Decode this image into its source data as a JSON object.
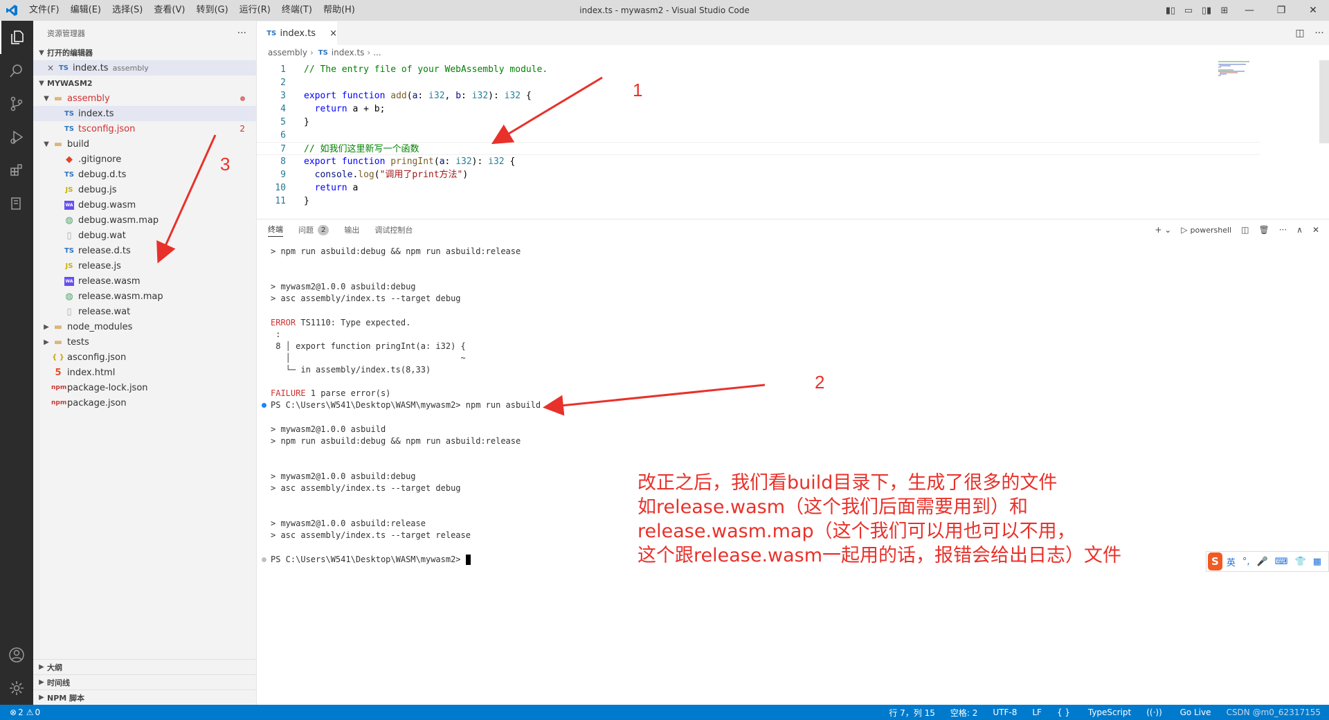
{
  "window": {
    "title": "index.ts - mywasm2 - Visual Studio Code",
    "menu": [
      "文件(F)",
      "编辑(E)",
      "选择(S)",
      "查看(V)",
      "转到(G)",
      "运行(R)",
      "终端(T)",
      "帮助(H)"
    ]
  },
  "sidebar": {
    "title": "资源管理器",
    "more": "···",
    "open_editors": {
      "label": "打开的编辑器",
      "items": [
        {
          "icon": "TS",
          "name": "index.ts",
          "desc": "assembly"
        }
      ]
    },
    "project": {
      "label": "MYWASM2",
      "tree": [
        {
          "icon": "folder",
          "name": "assembly",
          "level": 1,
          "open": true,
          "status": "red"
        },
        {
          "icon": "TS",
          "name": "index.ts",
          "level": 2,
          "selected": true
        },
        {
          "icon": "TS",
          "name": "tsconfig.json",
          "level": 2,
          "badge": "2",
          "status": "red"
        },
        {
          "icon": "folder",
          "name": "build",
          "level": 1,
          "open": true
        },
        {
          "icon": "git",
          "name": ".gitignore",
          "level": 2
        },
        {
          "icon": "TS",
          "name": "debug.d.ts",
          "level": 2
        },
        {
          "icon": "JS",
          "name": "debug.js",
          "level": 2
        },
        {
          "icon": "wasm",
          "name": "debug.wasm",
          "level": 2
        },
        {
          "icon": "globe",
          "name": "debug.wasm.map",
          "level": 2
        },
        {
          "icon": "file",
          "name": "debug.wat",
          "level": 2
        },
        {
          "icon": "TS",
          "name": "release.d.ts",
          "level": 2
        },
        {
          "icon": "JS",
          "name": "release.js",
          "level": 2
        },
        {
          "icon": "wasm",
          "name": "release.wasm",
          "level": 2
        },
        {
          "icon": "globe",
          "name": "release.wasm.map",
          "level": 2
        },
        {
          "icon": "file",
          "name": "release.wat",
          "level": 2
        },
        {
          "icon": "folder",
          "name": "node_modules",
          "level": 1,
          "open": false
        },
        {
          "icon": "folder",
          "name": "tests",
          "level": 1,
          "open": false
        },
        {
          "icon": "json",
          "name": "asconfig.json",
          "level": 1
        },
        {
          "icon": "html",
          "name": "index.html",
          "level": 1
        },
        {
          "icon": "npm",
          "name": "package-lock.json",
          "level": 1
        },
        {
          "icon": "npm",
          "name": "package.json",
          "level": 1
        }
      ]
    },
    "bottom_sections": [
      "大纲",
      "时间线",
      "NPM 脚本"
    ]
  },
  "editor": {
    "tab": {
      "icon": "TS",
      "label": "index.ts",
      "close": "×"
    },
    "breadcrumb": [
      "assembly",
      "index.ts",
      "..."
    ],
    "lines": [
      {
        "n": "1",
        "tokens": [
          {
            "t": "// The entry file of your WebAssembly module.",
            "c": "cm"
          }
        ]
      },
      {
        "n": "2",
        "tokens": []
      },
      {
        "n": "3",
        "tokens": [
          {
            "t": "export",
            "c": "kw"
          },
          {
            "t": " ",
            "c": "op"
          },
          {
            "t": "function",
            "c": "kw"
          },
          {
            "t": " ",
            "c": "op"
          },
          {
            "t": "add",
            "c": "fn"
          },
          {
            "t": "(",
            "c": "op"
          },
          {
            "t": "a",
            "c": "pr"
          },
          {
            "t": ": ",
            "c": "op"
          },
          {
            "t": "i32",
            "c": "ty"
          },
          {
            "t": ", ",
            "c": "op"
          },
          {
            "t": "b",
            "c": "pr"
          },
          {
            "t": ": ",
            "c": "op"
          },
          {
            "t": "i32",
            "c": "ty"
          },
          {
            "t": "): ",
            "c": "op"
          },
          {
            "t": "i32",
            "c": "ty"
          },
          {
            "t": " {",
            "c": "op"
          }
        ]
      },
      {
        "n": "4",
        "tokens": [
          {
            "t": "  ",
            "c": "op"
          },
          {
            "t": "return",
            "c": "kw"
          },
          {
            "t": " a + b;",
            "c": "op"
          }
        ]
      },
      {
        "n": "5",
        "tokens": [
          {
            "t": "}",
            "c": "op"
          }
        ]
      },
      {
        "n": "6",
        "tokens": []
      },
      {
        "n": "7",
        "tokens": [
          {
            "t": "// 如我们这里新写一个函数",
            "c": "cm"
          }
        ],
        "current": true
      },
      {
        "n": "8",
        "tokens": [
          {
            "t": "export",
            "c": "kw"
          },
          {
            "t": " ",
            "c": "op"
          },
          {
            "t": "function",
            "c": "kw"
          },
          {
            "t": " ",
            "c": "op"
          },
          {
            "t": "pringInt",
            "c": "fn"
          },
          {
            "t": "(",
            "c": "op"
          },
          {
            "t": "a",
            "c": "pr"
          },
          {
            "t": ": ",
            "c": "op"
          },
          {
            "t": "i32",
            "c": "ty"
          },
          {
            "t": "): ",
            "c": "op"
          },
          {
            "t": "i32",
            "c": "ty"
          },
          {
            "t": " {",
            "c": "op"
          }
        ]
      },
      {
        "n": "9",
        "tokens": [
          {
            "t": "  ",
            "c": "op"
          },
          {
            "t": "console",
            "c": "pr"
          },
          {
            "t": ".",
            "c": "op"
          },
          {
            "t": "log",
            "c": "fn"
          },
          {
            "t": "(",
            "c": "op"
          },
          {
            "t": "\"调用了print方法\"",
            "c": "str"
          },
          {
            "t": ")",
            "c": "op"
          }
        ]
      },
      {
        "n": "10",
        "tokens": [
          {
            "t": "  ",
            "c": "op"
          },
          {
            "t": "return",
            "c": "kw"
          },
          {
            "t": " a",
            "c": "op"
          }
        ]
      },
      {
        "n": "11",
        "tokens": [
          {
            "t": "}",
            "c": "op"
          }
        ]
      }
    ]
  },
  "panel": {
    "tabs": [
      {
        "label": "终端",
        "active": true
      },
      {
        "label": "问题",
        "badge": "2"
      },
      {
        "label": "输出"
      },
      {
        "label": "调试控制台"
      }
    ],
    "shell": "powershell",
    "terminal": [
      {
        "text": "> npm run asbuild:debug && npm run asbuild:release",
        "row": 0
      },
      {
        "text": "> mywasm2@1.0.0 asbuild:debug",
        "row": 3
      },
      {
        "text": "> asc assembly/index.ts --target debug",
        "row": 4
      },
      {
        "text": "ERROR TS1110: Type expected.",
        "row": 6,
        "err_prefix": "ERROR"
      },
      {
        "text": " :",
        "row": 7
      },
      {
        "text": " 8 │ export function pringInt(a: i32) {",
        "row": 8
      },
      {
        "text": "   │                                  ~",
        "row": 9
      },
      {
        "text": "   └─ in assembly/index.ts(8,33)",
        "row": 10
      },
      {
        "text": "FAILURE 1 parse error(s)",
        "row": 12,
        "err_prefix": "FAILURE"
      },
      {
        "text": "PS C:\\Users\\W541\\Desktop\\WASM\\mywasm2> npm run asbuild",
        "row": 13,
        "marker": "#1a85ff"
      },
      {
        "text": "> mywasm2@1.0.0 asbuild",
        "row": 15
      },
      {
        "text": "> npm run asbuild:debug && npm run asbuild:release",
        "row": 16
      },
      {
        "text": "> mywasm2@1.0.0 asbuild:debug",
        "row": 19
      },
      {
        "text": "> asc assembly/index.ts --target debug",
        "row": 20
      },
      {
        "text": "> mywasm2@1.0.0 asbuild:release",
        "row": 23
      },
      {
        "text": "> asc assembly/index.ts --target release",
        "row": 24
      },
      {
        "text": "PS C:\\Users\\W541\\Desktop\\WASM\\mywasm2> ",
        "row": 26,
        "marker": "#c0c0c0",
        "cursor": true
      }
    ]
  },
  "annotations": {
    "numbers": [
      "1",
      "2",
      "3"
    ],
    "text_lines": [
      "改正之后，我们看build目录下，生成了很多的文件",
      "如release.wasm（这个我们后面需要用到）和",
      "release.wasm.map（这个我们可以用也可以不用，",
      "这个跟release.wasm一起用的话，报错会给出日志）文件"
    ],
    "color": "#e8312a"
  },
  "ime": {
    "lang": "英",
    "punct": "°,"
  },
  "statusbar": {
    "errors": "2",
    "warnings": "0",
    "position": "行 7，列 15",
    "spaces": "空格: 2",
    "encoding": "UTF-8",
    "eol": "LF",
    "language": "TypeScript",
    "golive": "Go Live",
    "watermark": "CSDN @m0_62317155"
  },
  "colors": {
    "accent": "#007acc",
    "activity_bar": "#2c2c2c",
    "sidebar": "#f3f3f3"
  }
}
